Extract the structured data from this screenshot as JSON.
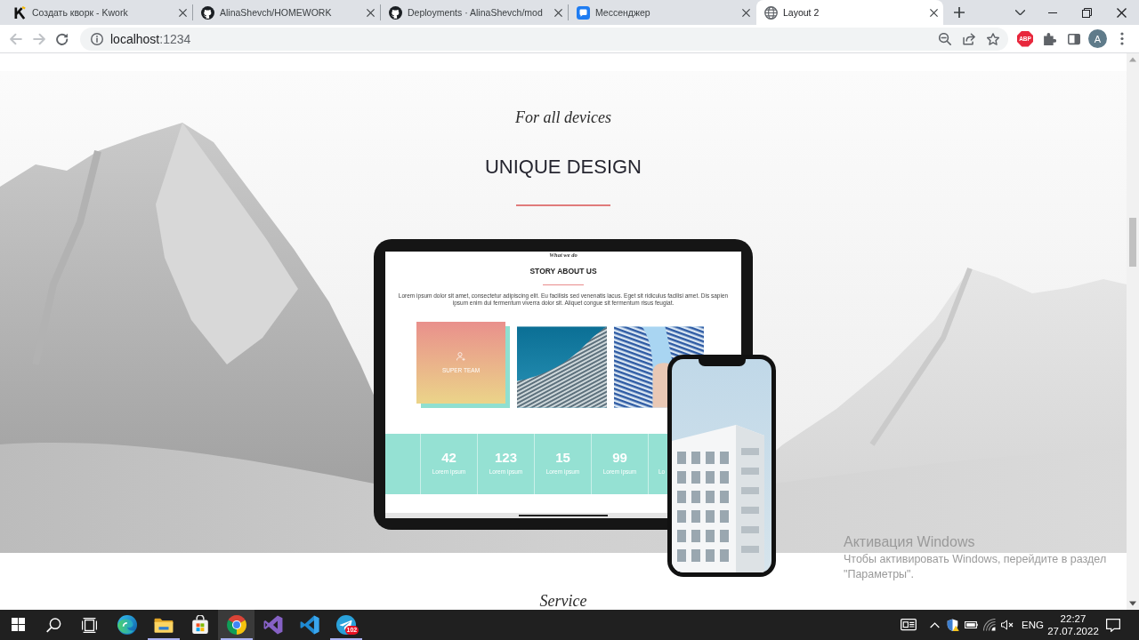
{
  "browser": {
    "tabs": [
      {
        "kind": "kwork",
        "title": "Создать кворк - Kwork",
        "selected": false
      },
      {
        "kind": "github",
        "title": "AlinaShevch/HOMEWORK",
        "selected": false
      },
      {
        "kind": "github",
        "title": "Deployments · AlinaShevch/mod",
        "selected": false
      },
      {
        "kind": "messenger",
        "title": "Мессенджер",
        "selected": false
      },
      {
        "kind": "globe",
        "title": "Layout 2",
        "selected": true
      }
    ],
    "nav": [
      {
        "kind": "back",
        "disabled": true
      },
      {
        "kind": "forward",
        "disabled": true
      },
      {
        "kind": "reload",
        "disabled": false
      }
    ],
    "address": {
      "host": "localhost",
      "port": ":1234"
    },
    "extensions": [
      {
        "kind": "adblock",
        "label": "ABP"
      },
      {
        "kind": "puzzle"
      },
      {
        "kind": "side_panel"
      }
    ],
    "profile": {
      "initial": "A"
    }
  },
  "page": {
    "subtitle": "For all devices",
    "title": "UNIQUE DESIGN",
    "tablet_screen": {
      "eyebrow": "What we do",
      "heading": "STORY ABOUT US",
      "text": "Lorem ipsum dolor sit amet, consectetur adipiscing elit. Eu facilisis sed venenatis lacus. Eget sit ridiculus facilisi amet. Dis sapien ipsum enim dui fermentum viverra dolor sit. Aliquet congue sit fermentum risus feugiat.",
      "cards": [
        {
          "kind": "team",
          "label": "SUPER TEAM"
        },
        {
          "kind": "facade"
        },
        {
          "kind": "tower"
        }
      ],
      "stats": [
        {
          "number": "42",
          "label": "Lorem ipsum"
        },
        {
          "number": "123",
          "label": "Lorem ipsum"
        },
        {
          "number": "15",
          "label": "Lorem ipsum"
        },
        {
          "number": "99",
          "label": "Lorem ipsum"
        },
        {
          "label": "Lo"
        }
      ]
    },
    "next_section": {
      "subtitle": "Service"
    }
  },
  "activation_notice": {
    "title": "Активация Windows",
    "text": "Чтобы активировать Windows, перейдите в раздел \"Параметры\"."
  },
  "taskbar": {
    "buttons": [
      {
        "kind": "start"
      },
      {
        "kind": "search"
      },
      {
        "kind": "task_view"
      }
    ],
    "apps": [
      {
        "kind": "edge",
        "running": false,
        "selected": false
      },
      {
        "kind": "explorer",
        "running": true,
        "selected": false
      },
      {
        "kind": "store",
        "running": false,
        "selected": false
      },
      {
        "kind": "chrome",
        "running": true,
        "selected": true
      },
      {
        "kind": "visual_studio",
        "running": false,
        "selected": false
      },
      {
        "kind": "vscode",
        "running": false,
        "selected": false
      },
      {
        "kind": "telegram",
        "running": true,
        "selected": false,
        "badge": "102"
      }
    ],
    "tray": {
      "language": "ENG",
      "time": "22:27",
      "date": "27.07.2022"
    }
  }
}
